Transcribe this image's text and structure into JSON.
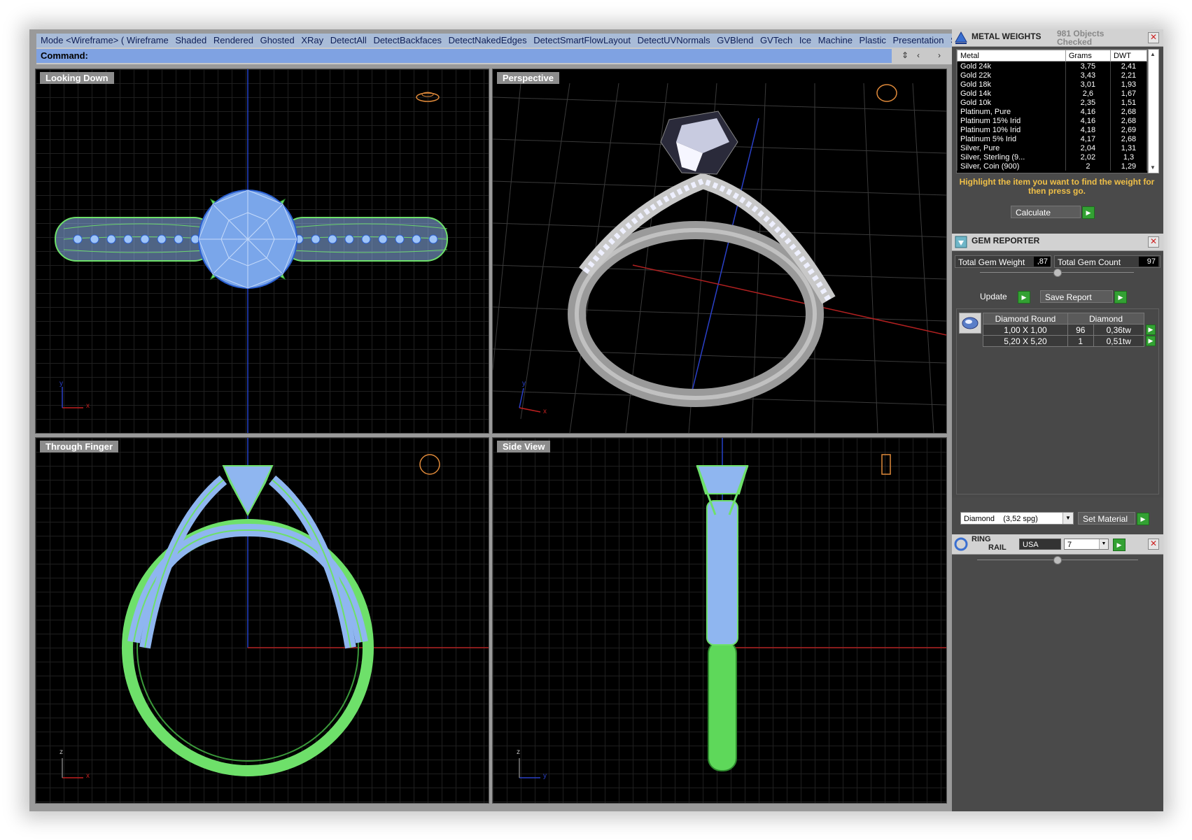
{
  "mode_bar": {
    "items": [
      "Mode <Wireframe> ( Wireframe",
      "Shaded",
      "Rendered",
      "Ghosted",
      "XRay",
      "DetectAll",
      "DetectBackfaces",
      "DetectNakedEdges",
      "DetectSmartFlowLayout",
      "DetectUVNormals",
      "GVBlend",
      "GVTech",
      "Ice",
      "Machine",
      "Plastic",
      "Presentation",
      "S"
    ]
  },
  "command": {
    "label": "Command:",
    "value": ""
  },
  "viewports": {
    "top_left": "Looking Down",
    "top_right": "Perspective",
    "bottom_left": "Through Finger",
    "bottom_right": "Side View"
  },
  "axis_labels": {
    "x": "x",
    "y": "y",
    "z": "z"
  },
  "metal_weights": {
    "title": "METAL WEIGHTS",
    "status_line1": "981 Objects",
    "status_line2": "Checked",
    "columns": [
      "Metal",
      "Grams",
      "DWT"
    ],
    "rows": [
      [
        "Gold 24k",
        "3,75",
        "2,41"
      ],
      [
        "Gold 22k",
        "3,43",
        "2,21"
      ],
      [
        "Gold 18k",
        "3,01",
        "1,93"
      ],
      [
        "Gold 14k",
        "2,6",
        "1,67"
      ],
      [
        "Gold 10k",
        "2,35",
        "1,51"
      ],
      [
        "Platinum, Pure",
        "4,16",
        "2,68"
      ],
      [
        "Platinum 15% Irid",
        "4,16",
        "2,68"
      ],
      [
        "Platinum 10% Irid",
        "4,18",
        "2,69"
      ],
      [
        "Platinum 5% Irid",
        "4,17",
        "2,68"
      ],
      [
        "Silver, Pure",
        "2,04",
        "1,31"
      ],
      [
        "Silver, Sterling (9...",
        "2,02",
        "1,3"
      ],
      [
        "Silver, Coin (900)",
        "2",
        "1,29"
      ]
    ],
    "hint": "Highlight the item you want to find the weight for then press go.",
    "calculate_label": "Calculate"
  },
  "gem_reporter": {
    "title": "GEM REPORTER",
    "total_weight_label": "Total Gem Weight",
    "total_weight_value": ",87",
    "total_count_label": "Total Gem Count",
    "total_count_value": "97",
    "update_label": "Update",
    "save_label": "Save Report",
    "table_header": [
      "Diamond Round",
      "Diamond"
    ],
    "rows": [
      [
        "1,00 X 1,00",
        "96",
        "0,36tw"
      ],
      [
        "5,20 X 5,20",
        "1",
        "0,51tw"
      ]
    ],
    "material_selected": "Diamond    (3,52 spg)",
    "set_material_label": "Set Material"
  },
  "ring_rail": {
    "title_line1": "RING",
    "title_line2": "RAIL",
    "country": "USA",
    "size": "7"
  },
  "colors": {
    "wire_green": "#6ee06a",
    "wire_blue": "#8fb6f0",
    "mode_bar_bg": "#a9bcd8",
    "command_bg": "#7fa2e2",
    "hint_yellow": "#f0c048",
    "go_green": "#33a133"
  }
}
